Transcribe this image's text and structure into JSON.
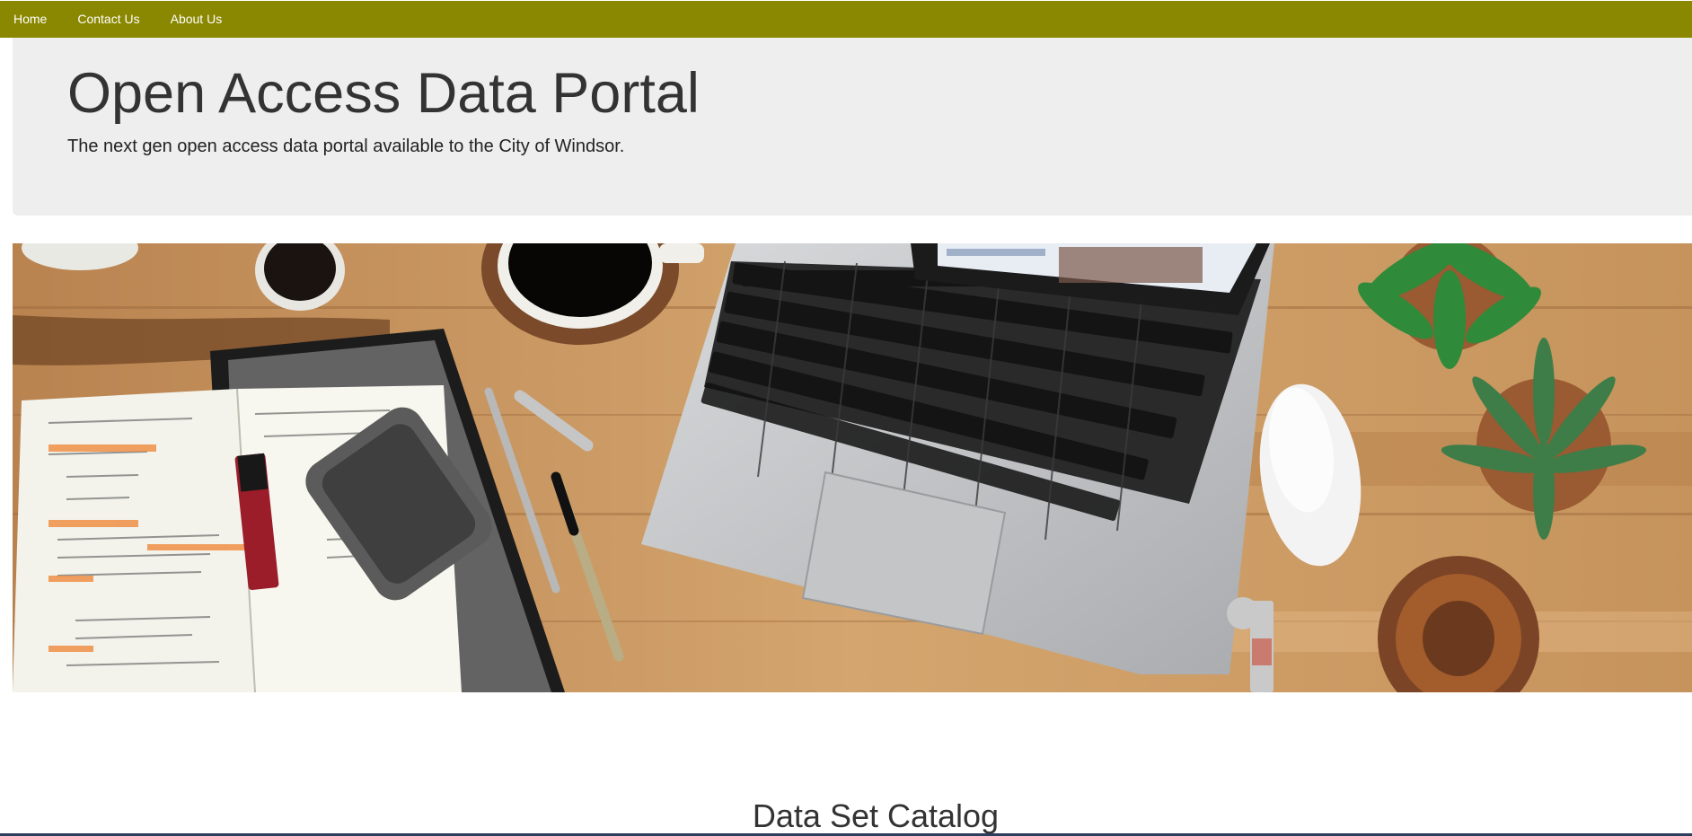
{
  "nav": {
    "items": [
      {
        "label": "Home"
      },
      {
        "label": "Contact Us"
      },
      {
        "label": "About Us"
      }
    ],
    "bg_color": "#8a8800"
  },
  "header": {
    "title": "Open Access Data Portal",
    "subtitle": "The next gen open access data portal available to the City of Windsor."
  },
  "hero": {
    "image_semantic": "desk-workspace-photo"
  },
  "main": {
    "section_title": "Data Set Catalog"
  }
}
